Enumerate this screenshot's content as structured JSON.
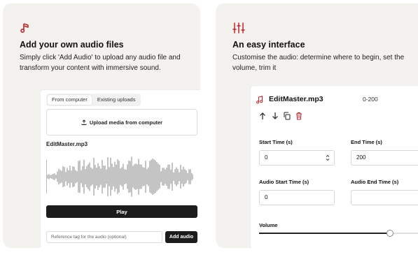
{
  "left_card": {
    "icon": "music-note-icon",
    "title": "Add your own audio files",
    "description": "Simply click 'Add Audio' to upload any audio file and transform your content with immersive sound.",
    "tabs": [
      {
        "label": "From computer",
        "active": true
      },
      {
        "label": "Existing uploads",
        "active": false
      }
    ],
    "upload_label": "Upload media from computer",
    "upload_icon": "upload-icon",
    "file_name": "EditMaster.mp3",
    "play_label": "Play",
    "tag_placeholder": "Reference tag for the audio (optional)",
    "add_audio_label": "Add audio"
  },
  "right_card": {
    "icon": "sliders-icon",
    "title": "An easy interface",
    "description": "Customise the audio: determine where to begin, set the volume, trim it",
    "file_name": "EditMaster.mp3",
    "file_icon": "music-note-icon",
    "range": "0-200",
    "controls": [
      "arrow-up-icon",
      "arrow-down-icon",
      "copy-icon",
      "trash-icon"
    ],
    "start_time": {
      "label": "Start Time (s)",
      "value": "0"
    },
    "end_time": {
      "label": "End Time (s)",
      "value": "200"
    },
    "audio_start": {
      "label": "Audio Start Time (s)",
      "value": "0"
    },
    "audio_end": {
      "label": "Audio End Time (s)",
      "value": ""
    },
    "volume": {
      "label": "Volume",
      "level": 0.78
    }
  },
  "colors": {
    "accent": "#c0262d",
    "card_bg": "#f4f2ef",
    "button_bg": "#1c1c1c"
  }
}
